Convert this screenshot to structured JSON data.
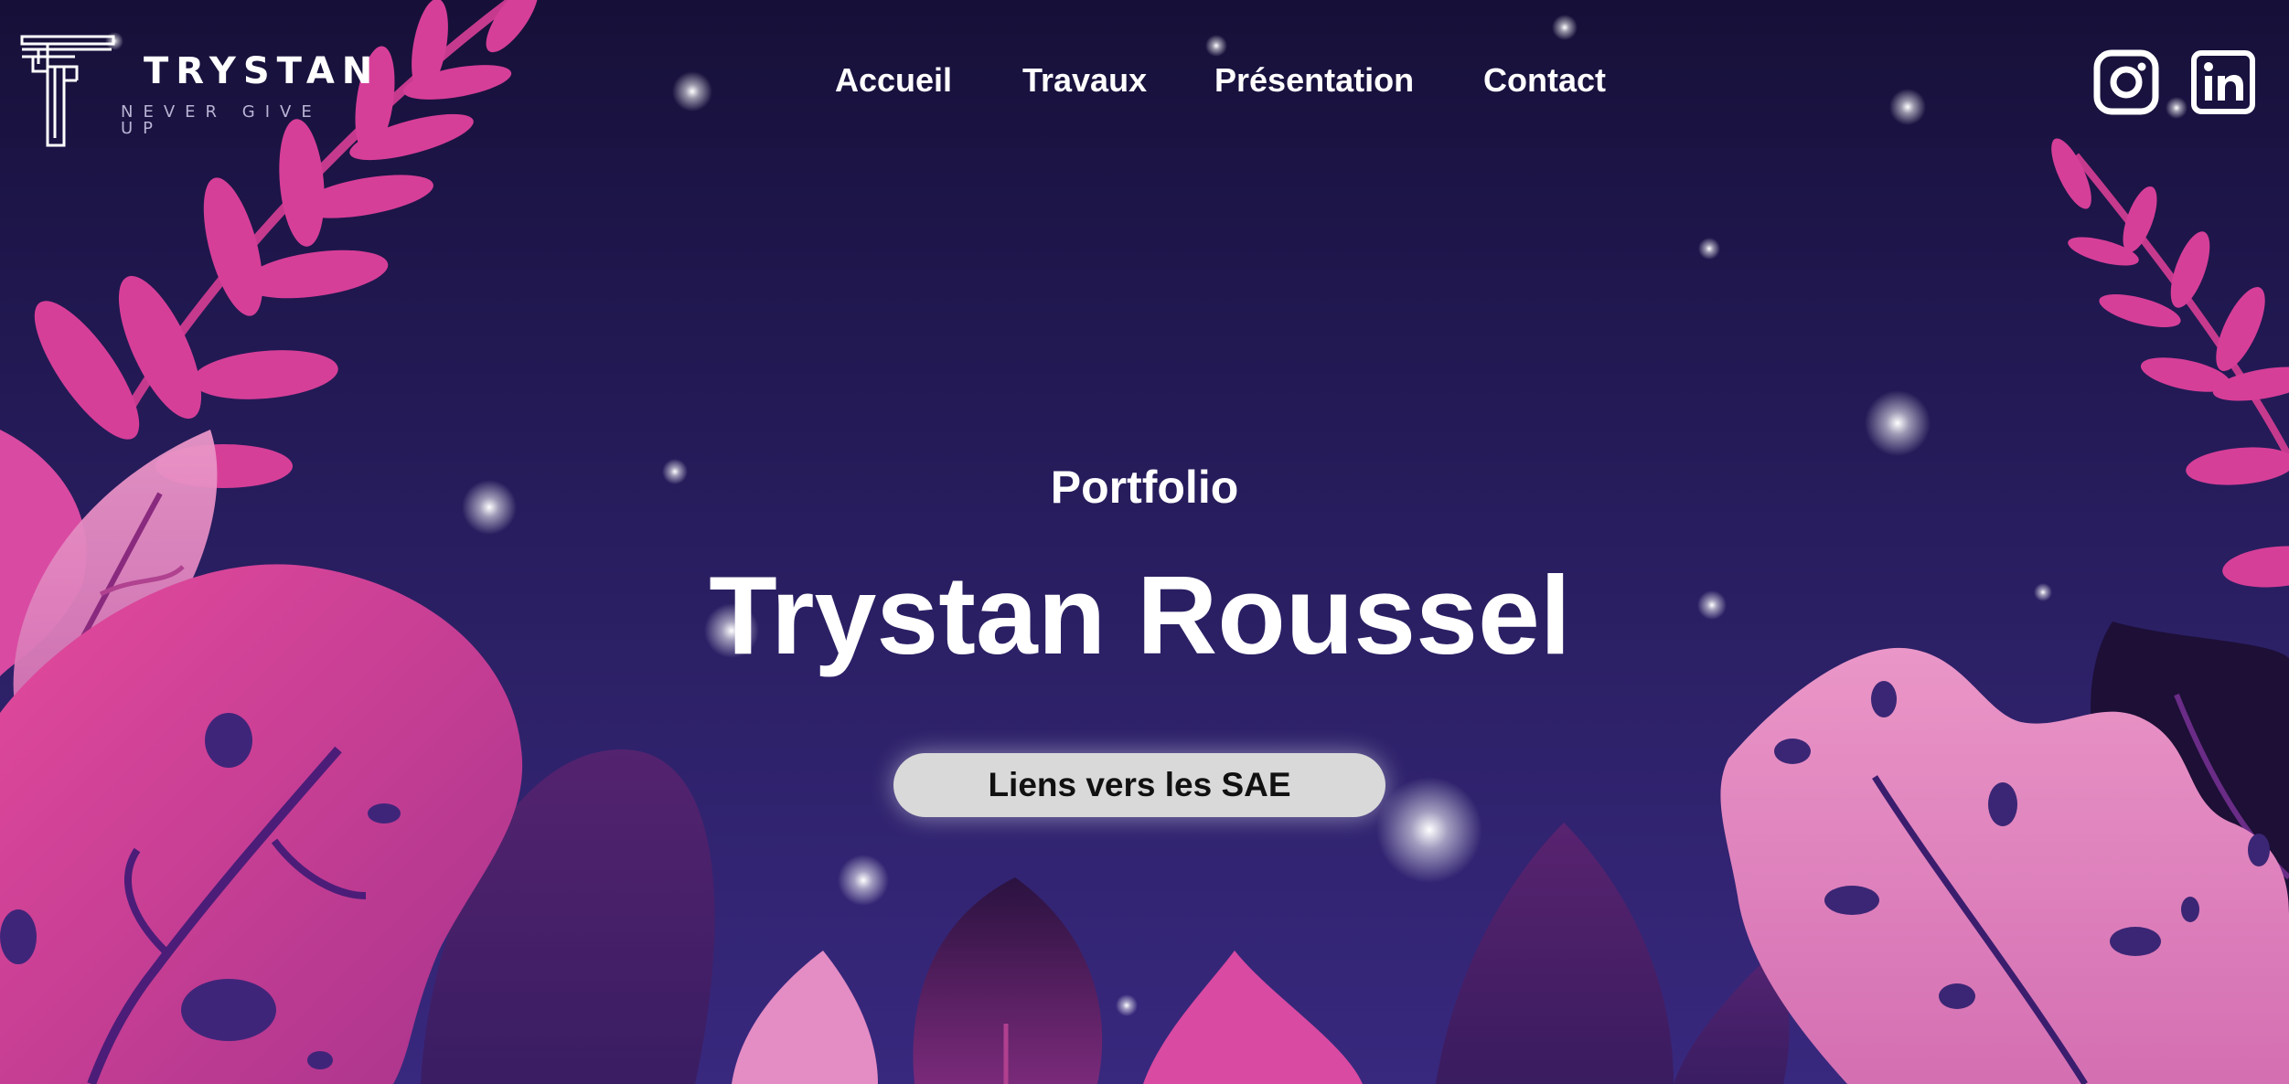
{
  "brand": {
    "name": "TRYSTAN",
    "tagline": "NEVER GIVE UP"
  },
  "nav": {
    "items": [
      {
        "label": "Accueil"
      },
      {
        "label": "Travaux"
      },
      {
        "label": "Présentation"
      },
      {
        "label": "Contact"
      }
    ]
  },
  "social": {
    "icons": [
      "instagram-icon",
      "linkedin-icon"
    ]
  },
  "hero": {
    "subtitle": "Portfolio",
    "title": "Trystan Roussel",
    "cta_label": "Liens vers les SAE"
  },
  "colors": {
    "background_top": "#161038",
    "background_bottom": "#38287e",
    "leaf_pink": "#e0409a",
    "leaf_light": "#e88cc4",
    "button_bg": "#d9d9d9",
    "text": "#ffffff"
  }
}
